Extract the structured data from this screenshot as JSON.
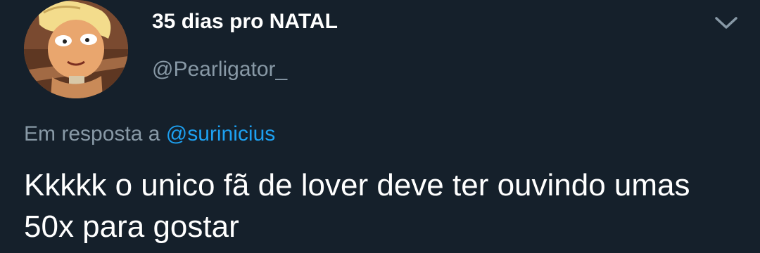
{
  "tweet": {
    "author": {
      "display_name": "35 dias pro NATAL",
      "handle": "@Pearligator_",
      "avatar_icon": "cartoon-character-avatar"
    },
    "menu_icon": "chevron-down-icon",
    "reply_context": {
      "prefix": "Em resposta a",
      "mention": "@surinicius"
    },
    "text": "Kkkkk o unico fã de lover deve ter ouvindo umas 50x para gostar"
  },
  "colors": {
    "background": "#15202b",
    "primary_text": "#ffffff",
    "secondary_text": "#8899a6",
    "accent": "#1da1f2"
  }
}
